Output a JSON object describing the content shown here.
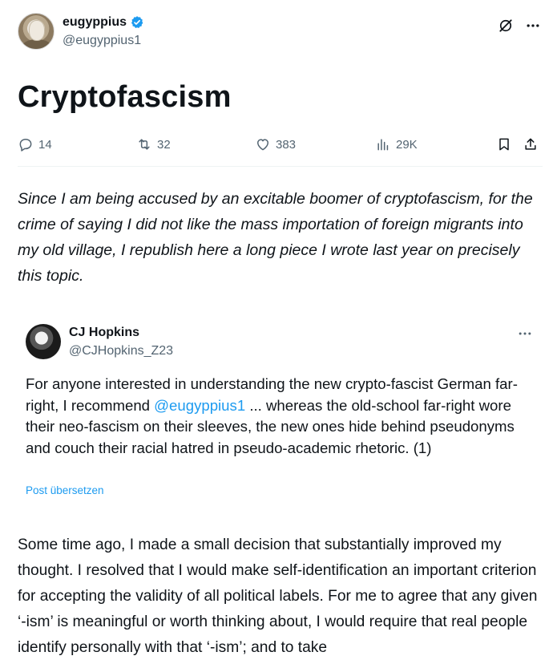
{
  "author": {
    "name": "eugyppius",
    "handle": "@eugyppius1"
  },
  "article": {
    "title": "Cryptofascism"
  },
  "stats": {
    "replies": "14",
    "reposts": "32",
    "likes": "383",
    "views": "29K"
  },
  "intro_text": "Since I am being accused by an excitable boomer of cryptofascism, for the crime of saying I did not like the mass importation of foreign migrants into my old village, I republish here a long piece I wrote last year on precisely this topic.",
  "quoted_post": {
    "name": "CJ Hopkins",
    "handle": "@CJHopkins_Z23",
    "text_before": "For anyone interested in understanding the new crypto-fascist German far-right, I recommend ",
    "mention": "@eugyppius1",
    "text_after": " ... whereas the old-school far-right wore their neo-fascism on their sleeves, the new ones hide behind pseudonyms and couch their racial hatred in pseudo-academic rhetoric. (1)",
    "translate_label": "Post übersetzen"
  },
  "body_text": "Some time ago, I made a small decision that substantially improved my thought. I resolved that I would make self-identification an important criterion for accepting the validity of all political labels. For me to agree that any given ‘-ism’ is meaningful or worth thinking about, I would require that real people identify personally with that ‘-ism’; and to take",
  "colors": {
    "text": "#0f1419",
    "muted": "#536471",
    "link": "#1d9bf0",
    "verified": "#1d9bf0"
  }
}
